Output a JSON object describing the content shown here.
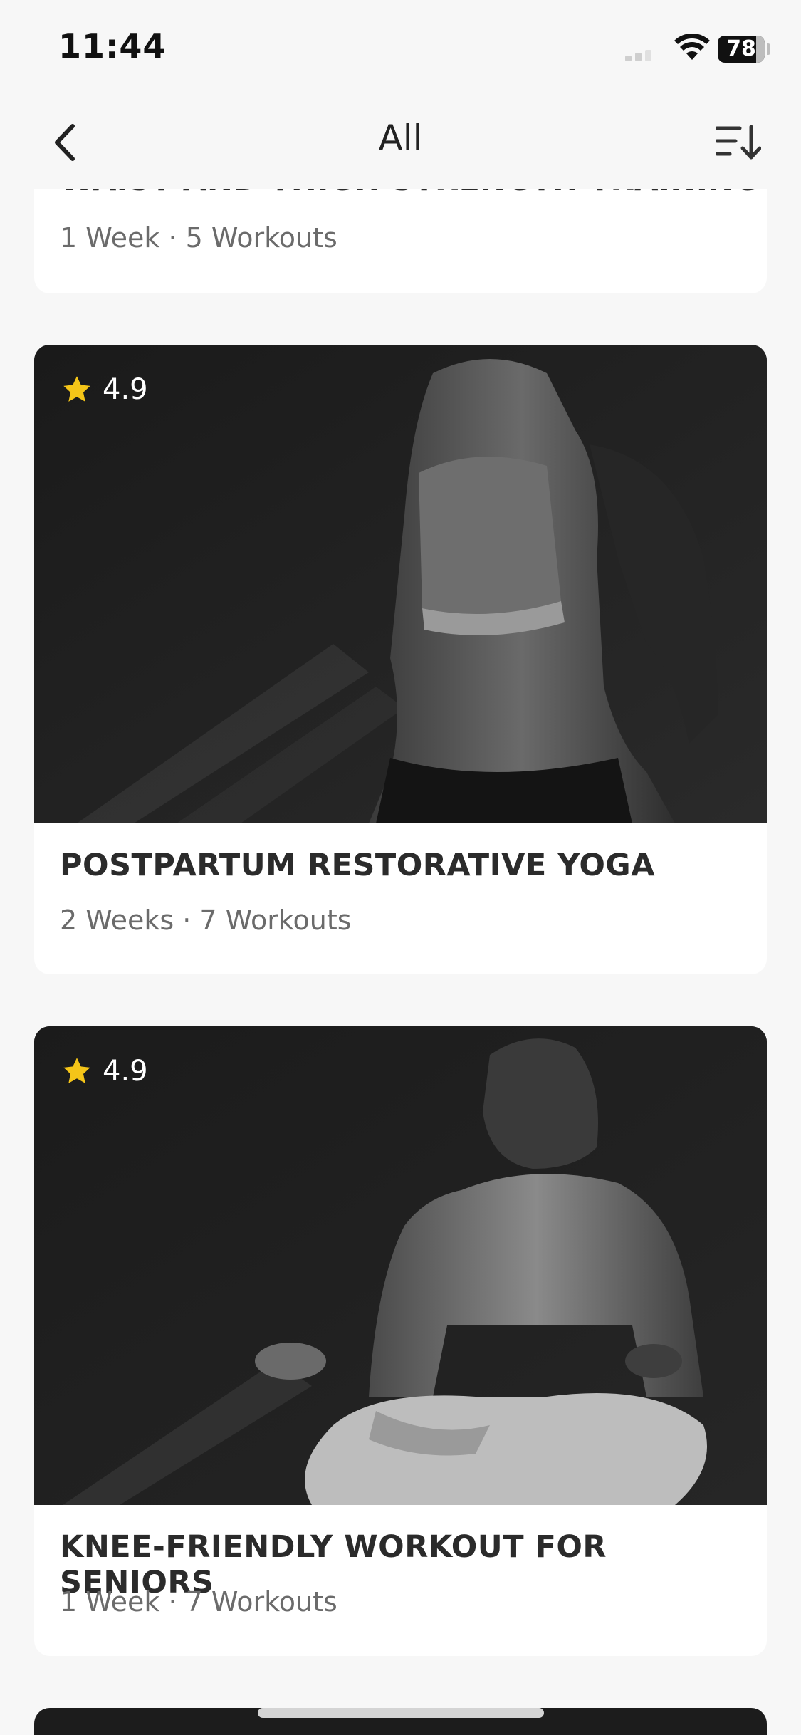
{
  "status": {
    "time": "11:44",
    "battery": "78"
  },
  "nav": {
    "title": "All",
    "back_icon": "chevron-left-icon",
    "sort_icon": "sort-icon"
  },
  "programs": [
    {
      "title": "WAIST AND THIGH STRENGTH TRAINING",
      "meta": "1 Week · 5 Workouts"
    },
    {
      "rating": "4.9",
      "title": "POSTPARTUM RESTORATIVE YOGA",
      "meta": "2 Weeks · 7 Workouts"
    },
    {
      "rating": "4.9",
      "title": "KNEE-FRIENDLY WORKOUT FOR SENIORS",
      "meta": "1 Week · 7 Workouts"
    }
  ],
  "colors": {
    "background": "#f7f7f7",
    "card": "#ffffff",
    "star": "#f5c518",
    "title": "#2b2b2b",
    "meta": "#6b6b6b"
  }
}
